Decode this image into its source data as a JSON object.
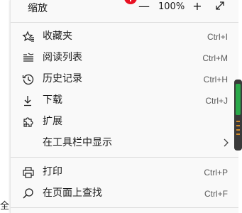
{
  "zoom": {
    "label": "缩放",
    "minus": "—",
    "value": "100%",
    "plus": "+"
  },
  "menu_items": [
    {
      "label": "收藏夹",
      "shortcut": "Ctrl+I",
      "icon": "favorites-star-icon"
    },
    {
      "label": "阅读列表",
      "shortcut": "Ctrl+M",
      "icon": "reading-list-icon"
    },
    {
      "label": "历史记录",
      "shortcut": "Ctrl+H",
      "icon": "history-clock-icon"
    },
    {
      "label": "下载",
      "shortcut": "Ctrl+J",
      "icon": "download-arrow-icon"
    },
    {
      "label": "扩展",
      "shortcut": "",
      "icon": "extensions-puzzle-icon"
    },
    {
      "label": "在工具栏中显示",
      "shortcut": "",
      "icon": ""
    },
    {
      "label": "打印",
      "shortcut": "Ctrl+P",
      "icon": "printer-icon"
    },
    {
      "label": "在页面上查找",
      "shortcut": "Ctrl+F",
      "icon": "search-icon"
    }
  ],
  "page_fragment": "全",
  "colors": {
    "menu_bg": "#f9f9f9",
    "separator": "#dcdcdc",
    "badge": "#e81123",
    "scroll_fill": "#2aa84a"
  }
}
